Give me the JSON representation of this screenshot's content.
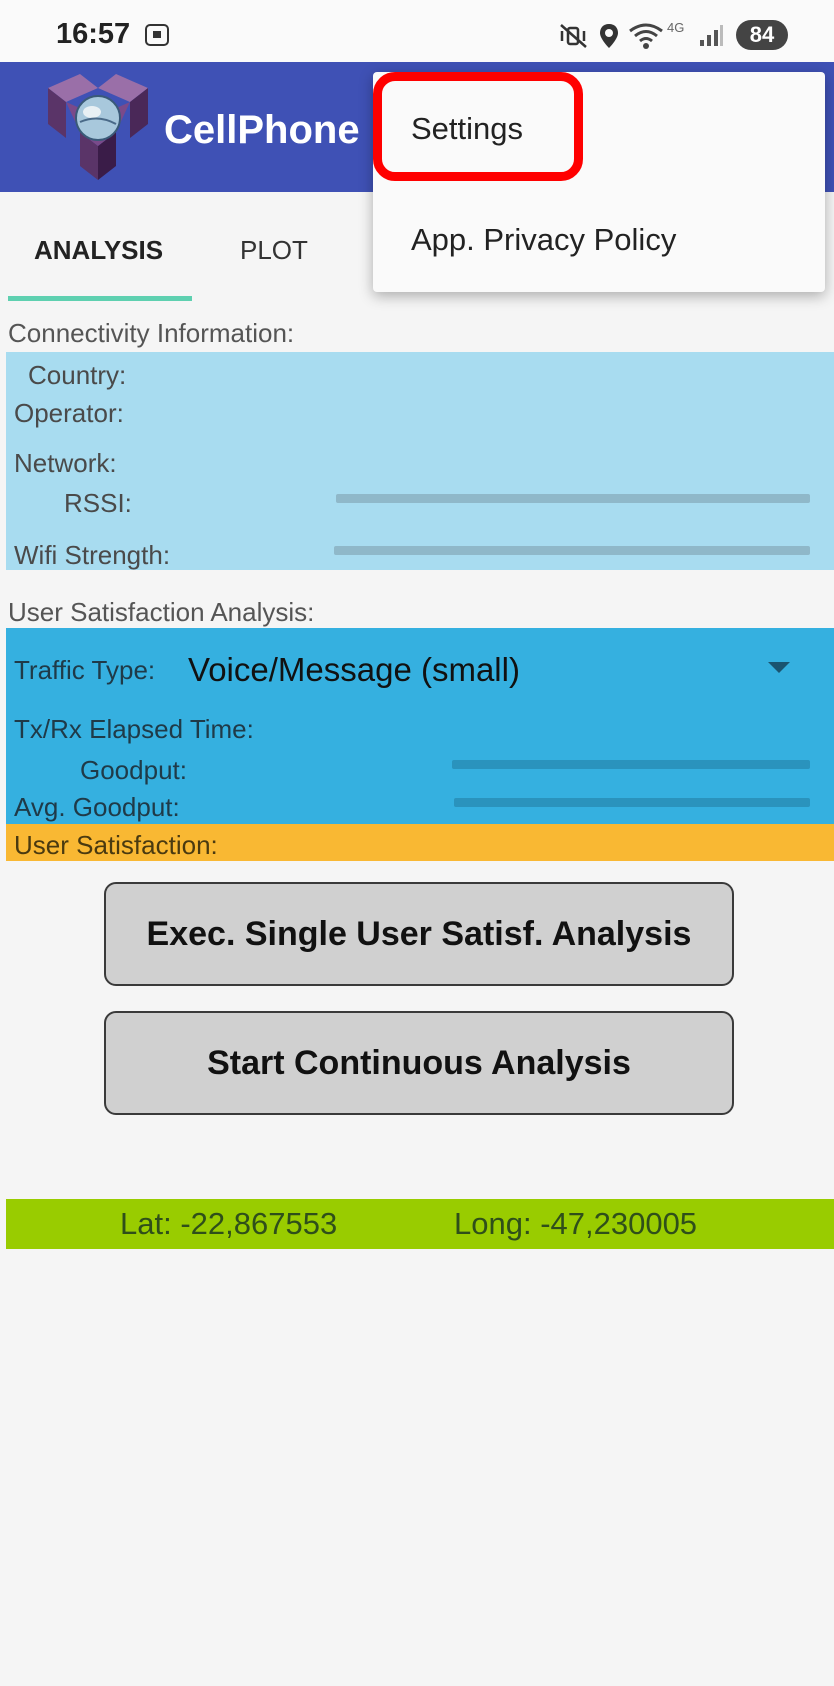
{
  "status_bar": {
    "time": "16:57",
    "battery": "84",
    "network_type": "4G",
    "icons": [
      "screen-record-icon",
      "mute-vibrate-icon",
      "location-icon",
      "wifi-icon",
      "signal-icon",
      "battery-icon"
    ]
  },
  "app_bar": {
    "title": "CellPhone",
    "brand_color": "#3f51b5"
  },
  "tabs": [
    {
      "label": "ANALYSIS",
      "selected": true
    },
    {
      "label": "PLOT",
      "selected": false
    }
  ],
  "connectivity": {
    "title": "Connectivity Information:",
    "country_label": "Country:",
    "operator_label": "Operator:",
    "network_label": "Network:",
    "rssi_label": "RSSI:",
    "wifi_label": "Wifi Strength:",
    "panel_color": "#a8dcf0"
  },
  "user_satisfaction": {
    "title": "User Satisfaction Analysis:",
    "traffic_type_label": "Traffic Type:",
    "traffic_type_value": "Voice/Message (small)",
    "elapsed_label": "Tx/Rx Elapsed Time:",
    "goodput_label": "Goodput:",
    "avg_goodput_label": "Avg. Goodput:",
    "satisfaction_label": "User Satisfaction:",
    "panel_color": "#35b0e0",
    "satisfaction_color": "#f9b833"
  },
  "buttons": {
    "single_analysis": "Exec. Single User Satisf. Analysis",
    "continuous_analysis": "Start Continuous Analysis"
  },
  "location": {
    "lat": "Lat: -22,867553",
    "long": "Long: -47,230005",
    "bar_color": "#99cc00"
  },
  "menu": {
    "items": [
      "Settings",
      "App. Privacy Policy"
    ],
    "highlighted_item": "Settings",
    "highlight_color": "#ff0000"
  }
}
